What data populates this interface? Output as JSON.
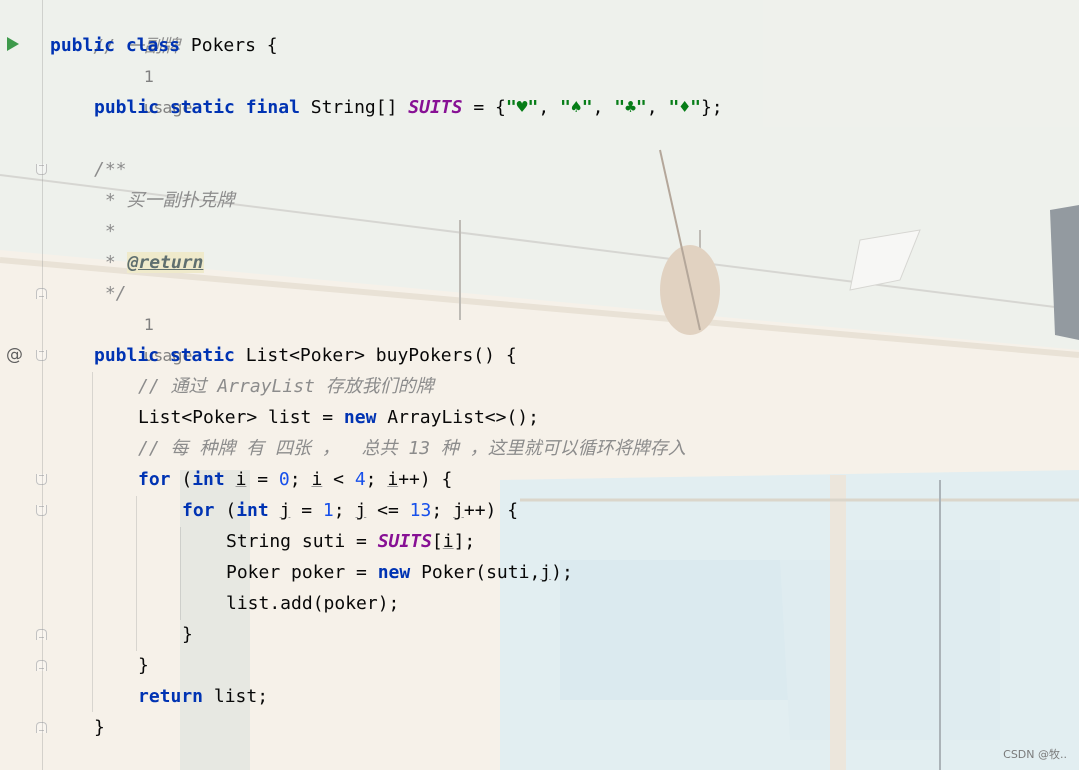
{
  "editor": {
    "usage_hint": "1 usage",
    "line_header_comment": "// 一副牌",
    "class_kw": "public class",
    "class_name": "Pokers",
    "open_brace": "{",
    "suits_decl": {
      "kw": "public static final",
      "type": "String[]",
      "name": "SUITS",
      "eq": " = {",
      "s1": "\"♥\"",
      "s2": "\"♠\"",
      "s3": "\"♣\"",
      "s4": "\"♦\"",
      "sep": ", ",
      "end": "};"
    },
    "javadoc": {
      "open": "/**",
      "line1": " * 买一副扑克牌",
      "line2": " *",
      "star": " * ",
      "tag": "@return",
      "close": " */"
    },
    "method": {
      "kw": "public static",
      "sig": " List<Poker> buyPokers() {"
    },
    "comment_arraylist": "// 通过 ArrayList 存放我们的牌",
    "list_decl_a": "List<Poker> list = ",
    "list_decl_new": "new",
    "list_decl_b": " ArrayList<>();",
    "comment_loop": "// 每 种牌 有 四张 ，  总共 13 种 ，这里就可以循环将牌存入",
    "for_i": {
      "kw": "for",
      "a": " (",
      "int": "int",
      "b1": " ",
      "v1": "i",
      "b2": " = ",
      "n0": "0",
      "b3": "; ",
      "v2": "i",
      "b4": " < ",
      "n4": "4",
      "b5": "; ",
      "v3": "i",
      "b6": "++) {"
    },
    "for_j": {
      "kw": "for",
      "a": " (",
      "int": "int",
      "b1": " ",
      "v1": "j",
      "b2": " = ",
      "n1": "1",
      "b3": "; ",
      "v2": "j",
      "b4": " <= ",
      "n13": "13",
      "b5": "; ",
      "v3": "j",
      "b6": "++) {"
    },
    "suti_a": "String suti = ",
    "suti_static": "SUITS",
    "suti_b": "[",
    "suti_i": "i",
    "suti_c": "];",
    "poker_a": "Poker poker = ",
    "poker_new": "new",
    "poker_b": " Poker(suti,",
    "poker_j": "j",
    "poker_c": ");",
    "list_add": "list.add(poker);",
    "close_brace": "}",
    "return_kw": "return",
    "return_rest": " list;"
  },
  "watermark": "CSDN @牧..",
  "colors": {
    "keyword": "#0033b3",
    "comment": "#8c8c8c",
    "static_field": "#871094",
    "number": "#1750eb",
    "string": "#067d17",
    "run_icon": "#3e9a4b"
  },
  "icons": [
    "run-icon",
    "implements-icon",
    "fold-icon"
  ]
}
